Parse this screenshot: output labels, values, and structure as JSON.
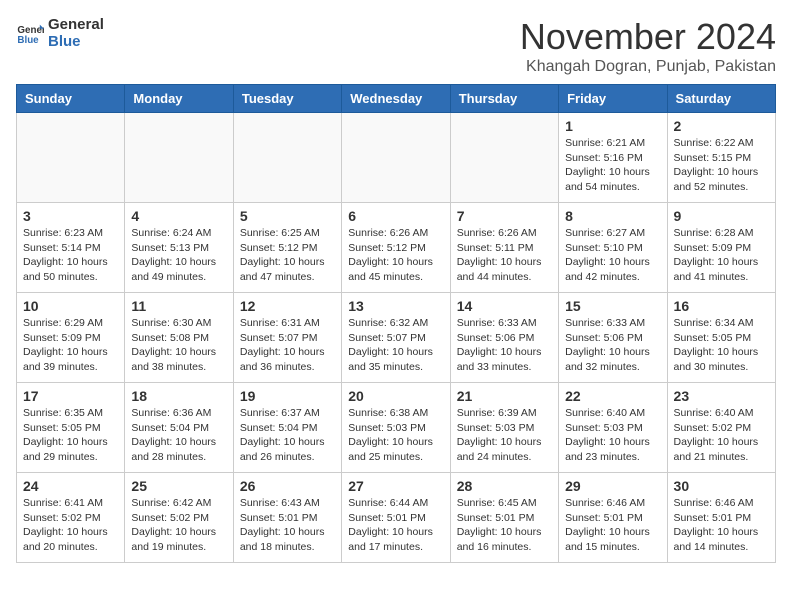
{
  "header": {
    "logo_line1": "General",
    "logo_line2": "Blue",
    "month_title": "November 2024",
    "location": "Khangah Dogran, Punjab, Pakistan"
  },
  "weekdays": [
    "Sunday",
    "Monday",
    "Tuesday",
    "Wednesday",
    "Thursday",
    "Friday",
    "Saturday"
  ],
  "weeks": [
    [
      {
        "day": "",
        "info": ""
      },
      {
        "day": "",
        "info": ""
      },
      {
        "day": "",
        "info": ""
      },
      {
        "day": "",
        "info": ""
      },
      {
        "day": "",
        "info": ""
      },
      {
        "day": "1",
        "info": "Sunrise: 6:21 AM\nSunset: 5:16 PM\nDaylight: 10 hours\nand 54 minutes."
      },
      {
        "day": "2",
        "info": "Sunrise: 6:22 AM\nSunset: 5:15 PM\nDaylight: 10 hours\nand 52 minutes."
      }
    ],
    [
      {
        "day": "3",
        "info": "Sunrise: 6:23 AM\nSunset: 5:14 PM\nDaylight: 10 hours\nand 50 minutes."
      },
      {
        "day": "4",
        "info": "Sunrise: 6:24 AM\nSunset: 5:13 PM\nDaylight: 10 hours\nand 49 minutes."
      },
      {
        "day": "5",
        "info": "Sunrise: 6:25 AM\nSunset: 5:12 PM\nDaylight: 10 hours\nand 47 minutes."
      },
      {
        "day": "6",
        "info": "Sunrise: 6:26 AM\nSunset: 5:12 PM\nDaylight: 10 hours\nand 45 minutes."
      },
      {
        "day": "7",
        "info": "Sunrise: 6:26 AM\nSunset: 5:11 PM\nDaylight: 10 hours\nand 44 minutes."
      },
      {
        "day": "8",
        "info": "Sunrise: 6:27 AM\nSunset: 5:10 PM\nDaylight: 10 hours\nand 42 minutes."
      },
      {
        "day": "9",
        "info": "Sunrise: 6:28 AM\nSunset: 5:09 PM\nDaylight: 10 hours\nand 41 minutes."
      }
    ],
    [
      {
        "day": "10",
        "info": "Sunrise: 6:29 AM\nSunset: 5:09 PM\nDaylight: 10 hours\nand 39 minutes."
      },
      {
        "day": "11",
        "info": "Sunrise: 6:30 AM\nSunset: 5:08 PM\nDaylight: 10 hours\nand 38 minutes."
      },
      {
        "day": "12",
        "info": "Sunrise: 6:31 AM\nSunset: 5:07 PM\nDaylight: 10 hours\nand 36 minutes."
      },
      {
        "day": "13",
        "info": "Sunrise: 6:32 AM\nSunset: 5:07 PM\nDaylight: 10 hours\nand 35 minutes."
      },
      {
        "day": "14",
        "info": "Sunrise: 6:33 AM\nSunset: 5:06 PM\nDaylight: 10 hours\nand 33 minutes."
      },
      {
        "day": "15",
        "info": "Sunrise: 6:33 AM\nSunset: 5:06 PM\nDaylight: 10 hours\nand 32 minutes."
      },
      {
        "day": "16",
        "info": "Sunrise: 6:34 AM\nSunset: 5:05 PM\nDaylight: 10 hours\nand 30 minutes."
      }
    ],
    [
      {
        "day": "17",
        "info": "Sunrise: 6:35 AM\nSunset: 5:05 PM\nDaylight: 10 hours\nand 29 minutes."
      },
      {
        "day": "18",
        "info": "Sunrise: 6:36 AM\nSunset: 5:04 PM\nDaylight: 10 hours\nand 28 minutes."
      },
      {
        "day": "19",
        "info": "Sunrise: 6:37 AM\nSunset: 5:04 PM\nDaylight: 10 hours\nand 26 minutes."
      },
      {
        "day": "20",
        "info": "Sunrise: 6:38 AM\nSunset: 5:03 PM\nDaylight: 10 hours\nand 25 minutes."
      },
      {
        "day": "21",
        "info": "Sunrise: 6:39 AM\nSunset: 5:03 PM\nDaylight: 10 hours\nand 24 minutes."
      },
      {
        "day": "22",
        "info": "Sunrise: 6:40 AM\nSunset: 5:03 PM\nDaylight: 10 hours\nand 23 minutes."
      },
      {
        "day": "23",
        "info": "Sunrise: 6:40 AM\nSunset: 5:02 PM\nDaylight: 10 hours\nand 21 minutes."
      }
    ],
    [
      {
        "day": "24",
        "info": "Sunrise: 6:41 AM\nSunset: 5:02 PM\nDaylight: 10 hours\nand 20 minutes."
      },
      {
        "day": "25",
        "info": "Sunrise: 6:42 AM\nSunset: 5:02 PM\nDaylight: 10 hours\nand 19 minutes."
      },
      {
        "day": "26",
        "info": "Sunrise: 6:43 AM\nSunset: 5:01 PM\nDaylight: 10 hours\nand 18 minutes."
      },
      {
        "day": "27",
        "info": "Sunrise: 6:44 AM\nSunset: 5:01 PM\nDaylight: 10 hours\nand 17 minutes."
      },
      {
        "day": "28",
        "info": "Sunrise: 6:45 AM\nSunset: 5:01 PM\nDaylight: 10 hours\nand 16 minutes."
      },
      {
        "day": "29",
        "info": "Sunrise: 6:46 AM\nSunset: 5:01 PM\nDaylight: 10 hours\nand 15 minutes."
      },
      {
        "day": "30",
        "info": "Sunrise: 6:46 AM\nSunset: 5:01 PM\nDaylight: 10 hours\nand 14 minutes."
      }
    ]
  ]
}
